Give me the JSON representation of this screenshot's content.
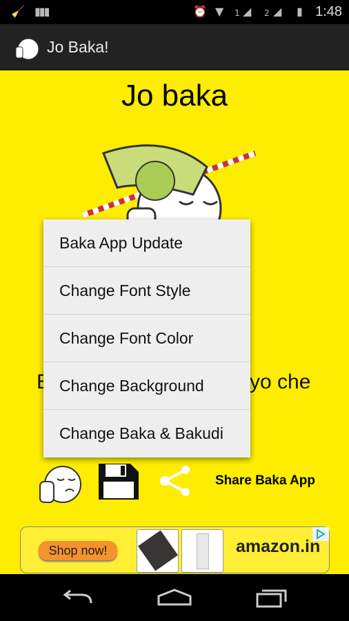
{
  "status_bar": {
    "time": "1:48",
    "sim1": "1",
    "sim2": "2",
    "icons": [
      "cleaner-icon",
      "barcode-icon",
      "alarm-icon",
      "wifi-icon",
      "signal-icon",
      "signal-roaming-icon",
      "battery-charging-icon"
    ]
  },
  "action_bar": {
    "title": "Jo Baka!",
    "icon": "baka-face-icon"
  },
  "content": {
    "heading": "Jo baka",
    "caption_left_fragment": "B",
    "caption_right_fragment": "yo che",
    "background_color": "#ffed00"
  },
  "menu": {
    "items": [
      {
        "label": "Baka App Update"
      },
      {
        "label": "Change Font Style"
      },
      {
        "label": "Change Font Color"
      },
      {
        "label": "Change Background"
      },
      {
        "label": "Change Baka & Bakudi"
      }
    ]
  },
  "toolbar": {
    "share_label": "Share Baka App",
    "icons": [
      "baka-face-icon",
      "save-icon",
      "share-icon"
    ]
  },
  "ad": {
    "button": "Shop now!",
    "brand": "amazon.in"
  }
}
